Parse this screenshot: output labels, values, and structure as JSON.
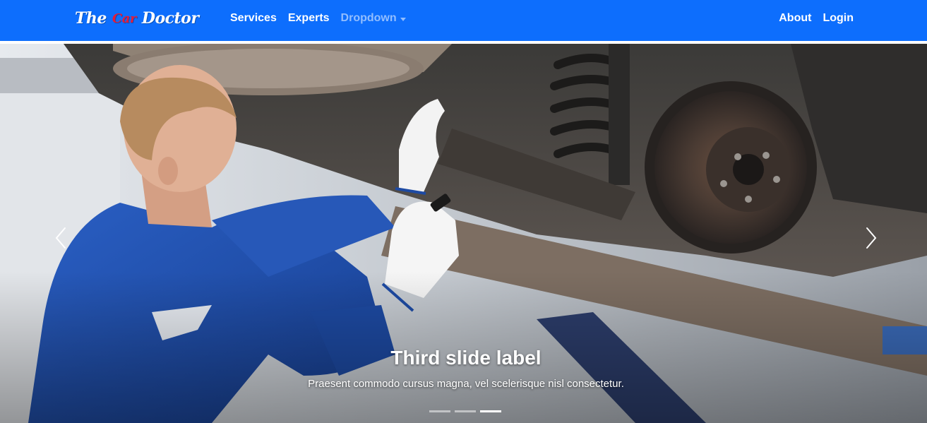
{
  "brand": {
    "word1": "The",
    "word2": "Car",
    "word3": "Doctor"
  },
  "nav": {
    "left": [
      {
        "label": "Services"
      },
      {
        "label": "Experts"
      },
      {
        "label": "Dropdown"
      }
    ],
    "right": [
      {
        "label": "About"
      },
      {
        "label": "Login"
      }
    ]
  },
  "carousel": {
    "caption_title": "Third slide label",
    "caption_text": "Praesent commodo cursus magna, vel scelerisque nisl consectetur.",
    "indicator_count": 3,
    "active_index": 2,
    "prev_icon": "chevron-left-icon",
    "next_icon": "chevron-right-icon"
  },
  "colors": {
    "navbar": "#0d6efd",
    "brand_accent": "#e31d3b",
    "uniform": "#1f4fb0"
  }
}
